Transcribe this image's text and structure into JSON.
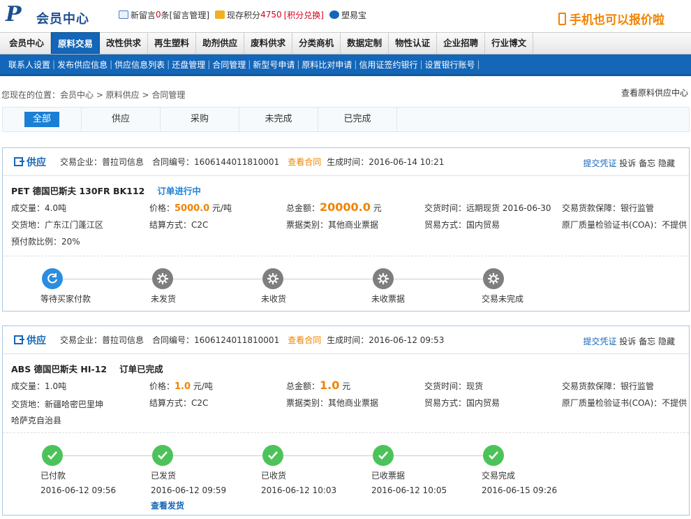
{
  "header": {
    "logo_text": "会员中心",
    "msg_prefix": "新留言",
    "msg_count": "0",
    "msg_unit": "条",
    "msg_link": "[留言管理]",
    "points_label": "现存积分",
    "points_value": "4750",
    "points_link": "[积分兑换]",
    "sub_app": "塑易宝",
    "promo": "手机也可以报价啦"
  },
  "main_nav": [
    "会员中心",
    "原料交易",
    "改性供求",
    "再生塑料",
    "助剂供应",
    "废料供求",
    "分类商机",
    "数据定制",
    "物性认证",
    "企业招聘",
    "行业博文"
  ],
  "main_nav_active": 1,
  "sub_nav": [
    "联系人设置",
    "发布供应信息",
    "供应信息列表",
    "还盘管理",
    "合同管理",
    "新型号申请",
    "原料比对申请",
    "信用证签约银行",
    "设置银行账号"
  ],
  "breadcrumb": "您现在的位置：会员中心 > 原料供应 > 合同管理",
  "breadcrumb_right": "查看原料供应中心",
  "filter_tabs": [
    "全部",
    "供应",
    "采购",
    "未完成",
    "已完成"
  ],
  "orders": [
    {
      "type": "供应",
      "company_label": "交易企业：",
      "company": "普拉司信息",
      "contract_label": "合同编号：",
      "contract_no": "1606144011810001",
      "view_contract": "查看合同",
      "time_label": "生成时间：",
      "time": "2016-06-14 10:21",
      "actions": [
        "提交凭证",
        "投诉",
        "备忘",
        "隐藏"
      ],
      "product": "PET 德国巴斯夫 130FR BK112",
      "state": "订单进行中",
      "qty": "成交量：4.0吨",
      "price_label": "价格：",
      "price": "5000.0",
      "price_unit": "元/吨",
      "total_label": "总金额：",
      "total": "20000.0",
      "total_unit": "元",
      "delivery_time": "交货时间：远期现货 2016-06-30",
      "guarantee": "交易货款保障：银行监管",
      "place": "交货地：广东江门蓬江区",
      "settle": "结算方式：C2C",
      "bill": "票据类别：其他商业票据",
      "trade": "贸易方式：国内贸易",
      "coa": "原厂质量检验证书(COA)：不提供",
      "prepay": "预付款比例：20%",
      "steps": [
        {
          "label": "等待买家付款",
          "status": "active"
        },
        {
          "label": "未发货",
          "status": "pending"
        },
        {
          "label": "未收货",
          "status": "pending"
        },
        {
          "label": "未收票据",
          "status": "pending"
        },
        {
          "label": "交易未完成",
          "status": "pending"
        }
      ]
    },
    {
      "type": "供应",
      "company_label": "交易企业：",
      "company": "普拉司信息",
      "contract_label": "合同编号：",
      "contract_no": "1606124011810001",
      "view_contract": "查看合同",
      "time_label": "生成时间：",
      "time": "2016-06-12 09:53",
      "actions": [
        "提交凭证",
        "投诉",
        "备忘",
        "隐藏"
      ],
      "product": "ABS 德国巴斯夫 HI-12",
      "state": "订单已完成",
      "qty": "成交量：1.0吨",
      "price_label": "价格：",
      "price": "1.0",
      "price_unit": "元/吨",
      "total_label": "总金额：",
      "total": "1.0",
      "total_unit": "元",
      "delivery_time": "交货时间：现货",
      "guarantee": "交易货款保障：银行监管",
      "place": "交货地：新疆哈密巴里坤哈萨克自治县",
      "settle": "结算方式：C2C",
      "bill": "票据类别：其他商业票据",
      "trade": "贸易方式：国内贸易",
      "coa": "原厂质量检验证书(COA)：不提供",
      "steps": [
        {
          "label": "已付款",
          "status": "done",
          "time": "2016-06-12 09:56"
        },
        {
          "label": "已发货",
          "status": "done",
          "time": "2016-06-12 09:59",
          "link": "查看发货"
        },
        {
          "label": "已收货",
          "status": "done",
          "time": "2016-06-12 10:03"
        },
        {
          "label": "已收票据",
          "status": "done",
          "time": "2016-06-12 10:05"
        },
        {
          "label": "交易完成",
          "status": "done",
          "time": "2016-06-15 09:26"
        }
      ]
    }
  ]
}
